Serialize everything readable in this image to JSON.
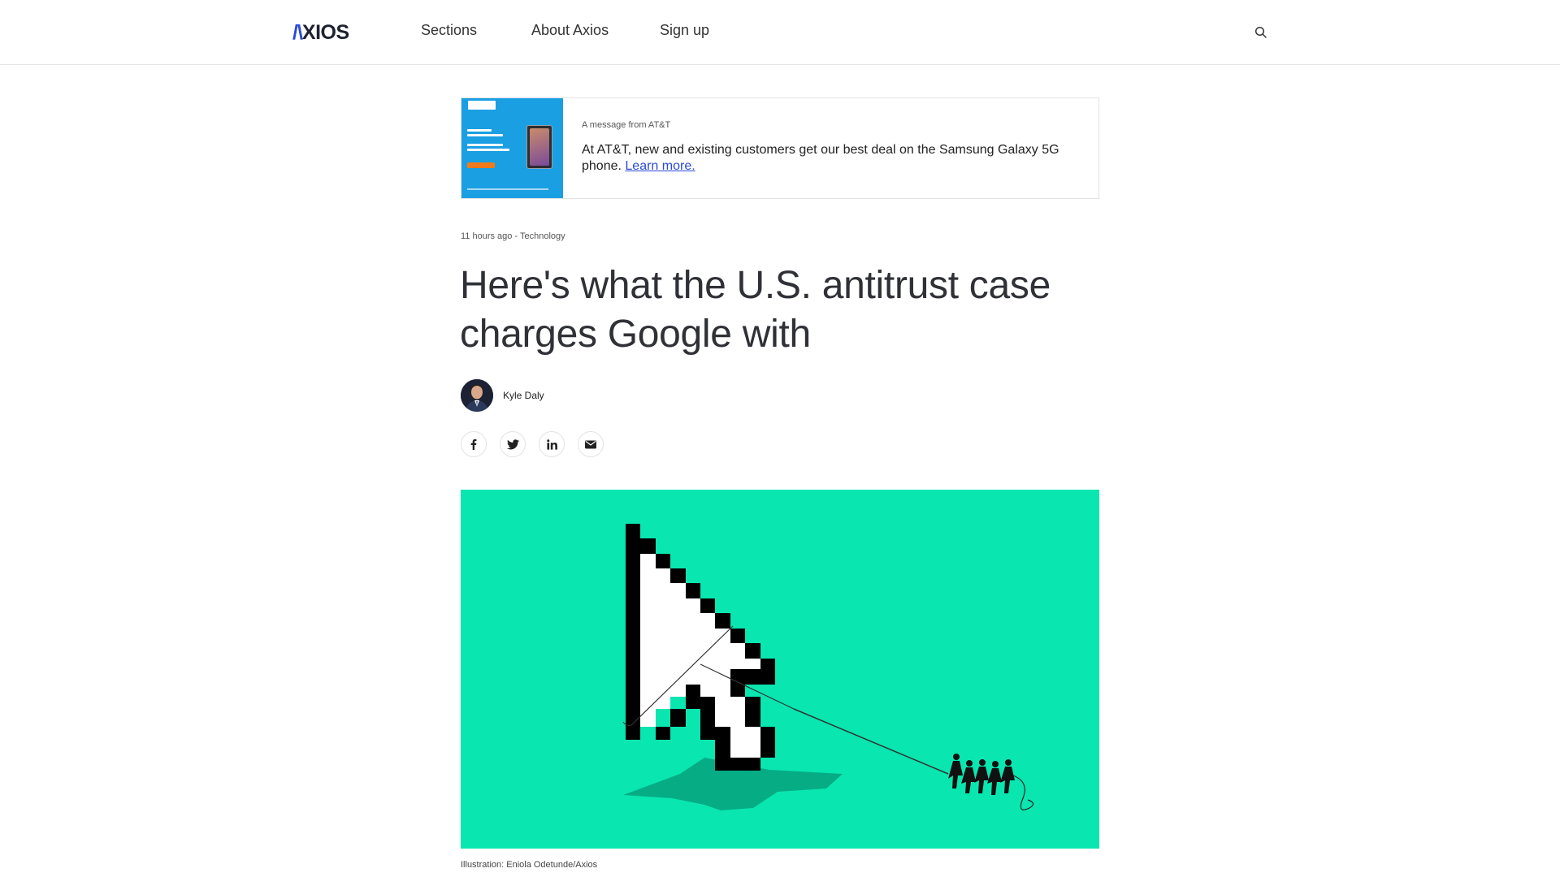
{
  "header": {
    "logo": {
      "mark": "/\\",
      "text": "XIOS"
    },
    "nav": [
      "Sections",
      "About Axios",
      "Sign up"
    ],
    "search_icon": "search-icon"
  },
  "ad": {
    "label": "A message from AT&T",
    "text": "At AT&T, new and existing customers get our best deal on the Samsung Galaxy 5G phone.",
    "link": "Learn more."
  },
  "article": {
    "meta": "11 hours ago - Technology",
    "headline": "Here's what the U.S. antitrust case charges Google with",
    "author": "Kyle Daly",
    "share_icons": [
      "facebook-icon",
      "twitter-icon",
      "linkedin-icon",
      "email-icon"
    ],
    "caption": "Illustration: Eniola Odetunde/Axios"
  },
  "colors": {
    "brand_blue": "#2a4ad8",
    "hero_bg": "#09e6b0"
  }
}
